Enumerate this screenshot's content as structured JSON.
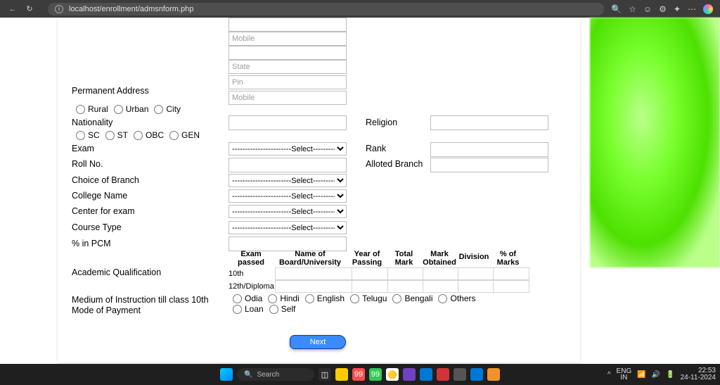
{
  "browser": {
    "url": "localhost/enrollment/admsnform.php"
  },
  "placeholders": {
    "mobile": "Mobile",
    "state": "State",
    "pin": "Pin"
  },
  "labels": {
    "perm_addr": "Permanent Address",
    "nationality": "Nationality",
    "religion": "Religion",
    "exam": "Exam",
    "rank": "Rank",
    "rollno": "Roll No.",
    "alloted_branch": "Alloted Branch",
    "choice_branch": "Choice of Branch",
    "college_name": "College Name",
    "center_exam": "Center for exam",
    "course_type": "Course Type",
    "pct_pcm": "% in PCM",
    "acad_qual": "Academic Qualification",
    "medium": "Medium of Instruction till class 10th",
    "mode_pay": "Mode of Payment"
  },
  "radios": {
    "area": [
      "Rural",
      "Urban",
      "City"
    ],
    "caste": [
      "SC",
      "ST",
      "OBC",
      "GEN"
    ],
    "medium": [
      "Odia",
      "Hindi",
      "English",
      "Telugu",
      "Bengali",
      "Others"
    ],
    "pay": [
      "Loan",
      "Self"
    ]
  },
  "select_ph": "-----------------------Select-----------------------",
  "table": {
    "headers": [
      "Exam passed",
      "Name of Board/University",
      "Year of Passing",
      "Total Mark",
      "Mark Obtained",
      "Division",
      "% of Marks"
    ],
    "rows": [
      "10th",
      "12th/Diploma"
    ]
  },
  "button": {
    "next": "Next"
  },
  "taskbar": {
    "search": "Search",
    "lang1": "ENG",
    "lang2": "IN",
    "time": "22:53",
    "date": "24-11-2024"
  }
}
